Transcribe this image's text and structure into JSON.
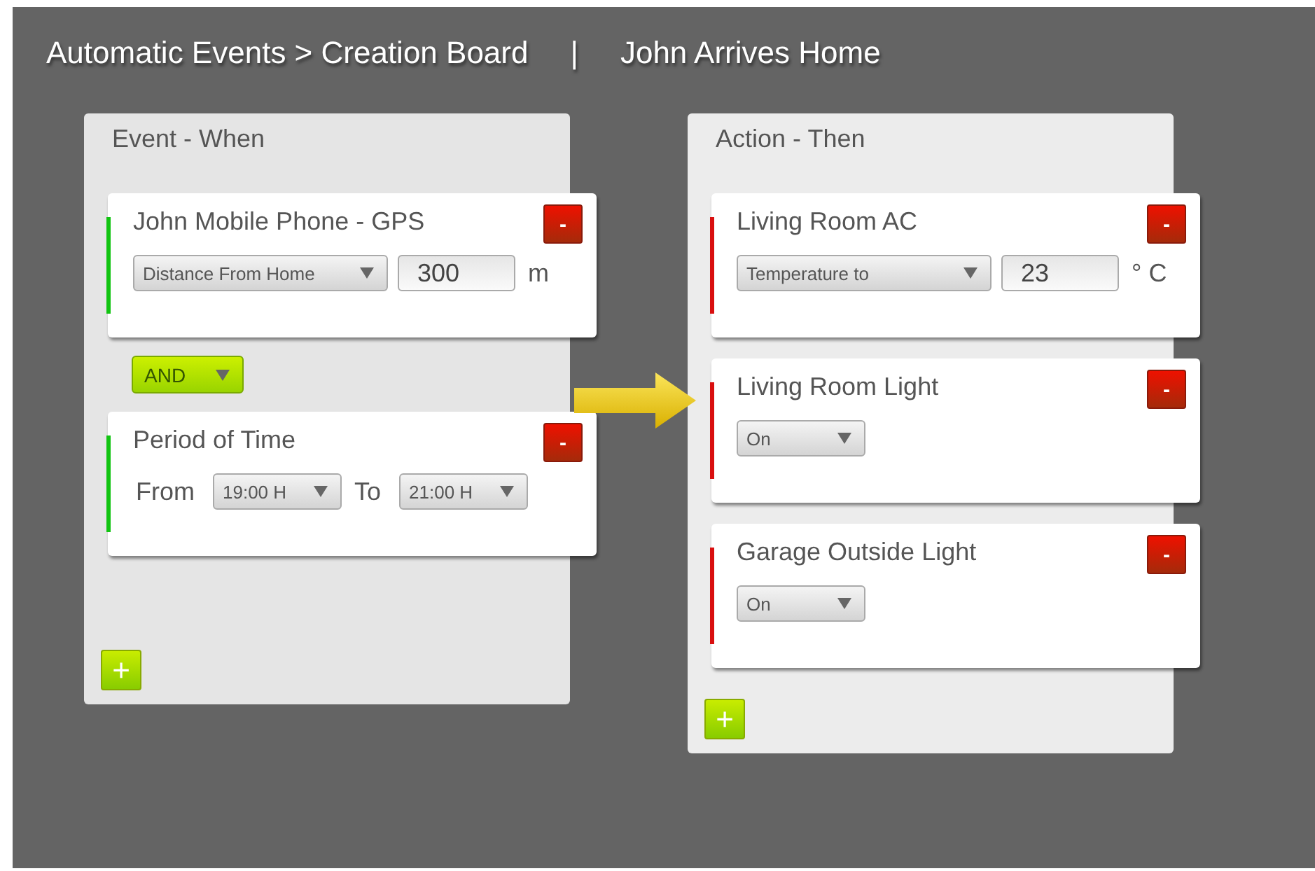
{
  "header": {
    "breadcrumb": "Automatic Events > Creation Board",
    "separator": "|",
    "rule_name": "John Arrives Home"
  },
  "panels": [
    {
      "title": "Event - When",
      "color": "#11c411",
      "add_label": "+",
      "items": [
        {
          "kind": "card",
          "title": "John Mobile Phone - GPS",
          "remove_label": "-",
          "controls": [
            {
              "kind": "dropdown",
              "value": "Distance From Home"
            },
            {
              "kind": "input",
              "value": "300"
            },
            {
              "kind": "label",
              "text": "m"
            }
          ]
        },
        {
          "kind": "connector",
          "value": "AND"
        },
        {
          "kind": "card",
          "title": "Period of Time",
          "remove_label": "-",
          "controls": [
            {
              "kind": "label",
              "text": "From"
            },
            {
              "kind": "dropdown",
              "value": "19:00 H"
            },
            {
              "kind": "label",
              "text": "To"
            },
            {
              "kind": "dropdown",
              "value": "21:00 H"
            }
          ]
        }
      ]
    },
    {
      "title": "Action - Then",
      "color": "#d90f0f",
      "add_label": "+",
      "items": [
        {
          "kind": "card",
          "title": "Living Room AC",
          "remove_label": "-",
          "controls": [
            {
              "kind": "dropdown",
              "value": "Temperature to"
            },
            {
              "kind": "input",
              "value": "23"
            },
            {
              "kind": "label",
              "text": "° C"
            }
          ]
        },
        {
          "kind": "card",
          "title": "Living Room Light",
          "remove_label": "-",
          "controls": [
            {
              "kind": "dropdown",
              "value": "On"
            }
          ]
        },
        {
          "kind": "card",
          "title": "Garage Outside Light",
          "remove_label": "-",
          "controls": [
            {
              "kind": "dropdown",
              "value": "On"
            }
          ]
        }
      ]
    }
  ]
}
